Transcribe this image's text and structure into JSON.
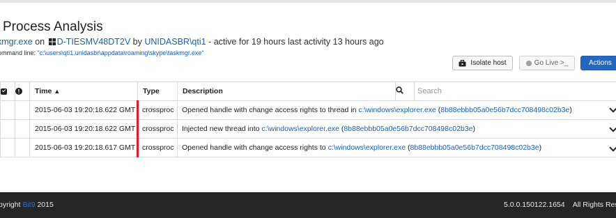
{
  "header": {
    "title": "Process Analysis",
    "process_name": "kmgr.exe",
    "on_text": "on",
    "host_name": "D-TIESMV48DT2V",
    "by_text": "by",
    "user_name": "UNIDASBR\\qti1",
    "activity_text": "- active for 19 hours last activity 13 hours ago",
    "cmdline_label": "ommand line:",
    "cmdline_value": "\"c:\\users\\qti1.unidasbr\\appdata\\roaming\\skype\\taskmgr.exe\""
  },
  "toolbar": {
    "isolate_label": "Isolate host",
    "golive_label": "Go Live >_",
    "actions_label": "Actions"
  },
  "table": {
    "headers": {
      "time": "Time",
      "type": "Type",
      "description": "Description"
    },
    "search_placeholder": "Search",
    "rows": [
      {
        "time": "2015-06-03 19:20:18.622 GMT",
        "type": "crossproc",
        "desc_prefix": "Opened handle with change access rights to thread in",
        "path": "c:\\windows\\explorer.exe",
        "hash": "8b88ebbb05a0e56b7dcc708498c02b3e"
      },
      {
        "time": "2015-06-03 19:20:18.622 GMT",
        "type": "crossproc",
        "desc_prefix": "Injected new thread into",
        "path": "c:\\windows\\explorer.exe",
        "hash": "8b88ebbb05a0e56b7dcc708498c02b3e"
      },
      {
        "time": "2015-06-03 19:20:18.617 GMT",
        "type": "crossproc",
        "desc_prefix": "Opened handle with change access rights to",
        "path": "c:\\windows\\explorer.exe",
        "hash": "8b88ebbb05a0e56b7dcc708498c02b3e"
      }
    ]
  },
  "footer": {
    "copyright_prefix": "pyright",
    "brand": "Bit9",
    "year": "2015",
    "version": "5.0.0.150122.1654",
    "rights": "All Rights Res"
  },
  "colors": {
    "link": "#1a5fb4",
    "type_marker": "#e31b23",
    "actions_button": "#2466c4",
    "footer_bg": "#262626"
  }
}
